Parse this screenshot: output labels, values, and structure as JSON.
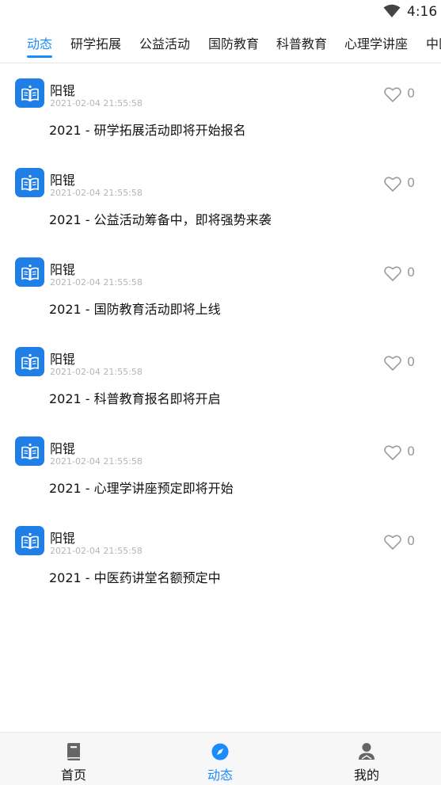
{
  "status_bar": {
    "time": "4:16",
    "wifi_icon": "wifi-icon"
  },
  "tabs": [
    {
      "label": "动态",
      "active": true
    },
    {
      "label": "研学拓展",
      "active": false
    },
    {
      "label": "公益活动",
      "active": false
    },
    {
      "label": "国防教育",
      "active": false
    },
    {
      "label": "科普教育",
      "active": false
    },
    {
      "label": "心理学讲座",
      "active": false
    },
    {
      "label": "中医药讲堂",
      "active": false
    }
  ],
  "posts": [
    {
      "author": "阳锟",
      "time": "2021-02-04 21:55:58",
      "title": "2021 - 研学拓展活动即将开始报名",
      "likes": "0"
    },
    {
      "author": "阳锟",
      "time": "2021-02-04 21:55:58",
      "title": "2021 - 公益活动筹备中，即将强势来袭",
      "likes": "0"
    },
    {
      "author": "阳锟",
      "time": "2021-02-04 21:55:58",
      "title": "2021 - 国防教育活动即将上线",
      "likes": "0"
    },
    {
      "author": "阳锟",
      "time": "2021-02-04 21:55:58",
      "title": "2021 - 科普教育报名即将开启",
      "likes": "0"
    },
    {
      "author": "阳锟",
      "time": "2021-02-04 21:55:58",
      "title": "2021 - 心理学讲座预定即将开始",
      "likes": "0"
    },
    {
      "author": "阳锟",
      "time": "2021-02-04 21:55:58",
      "title": "2021 - 中医药讲堂名额预定中",
      "likes": "0"
    }
  ],
  "bottom_nav": [
    {
      "label": "首页",
      "icon": "book-icon",
      "active": false
    },
    {
      "label": "动态",
      "icon": "compass-icon",
      "active": true
    },
    {
      "label": "我的",
      "icon": "user-icon",
      "active": false
    }
  ],
  "colors": {
    "accent": "#1a8cff",
    "avatar": "#1f7fe6",
    "timestamp": "#b5b5b5"
  }
}
